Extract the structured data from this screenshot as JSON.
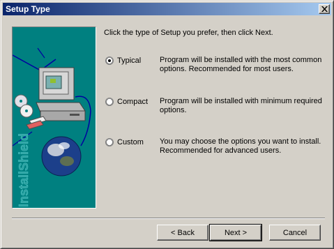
{
  "window": {
    "title": "Setup Type",
    "close_icon": "close-icon"
  },
  "panel": {
    "graphic": "installshield-computer-graphic",
    "brand_text": "InstallShield"
  },
  "instruction": "Click the type of Setup you prefer, then click Next.",
  "options": [
    {
      "label": "Typical",
      "selected": true,
      "description": "Program will be installed with the most common options.  Recommended for most users."
    },
    {
      "label": "Compact",
      "selected": false,
      "description": "Program will be installed with minimum required options."
    },
    {
      "label": "Custom",
      "selected": false,
      "description": "You may choose the options you want to install. Recommended for advanced users."
    }
  ],
  "buttons": {
    "back": "< Back",
    "next": "Next >",
    "cancel": "Cancel"
  },
  "colors": {
    "titlebar_start": "#0a246a",
    "titlebar_end": "#a6caf0",
    "panel_bg": "#008080",
    "dialog_bg": "#d4d0c8"
  }
}
